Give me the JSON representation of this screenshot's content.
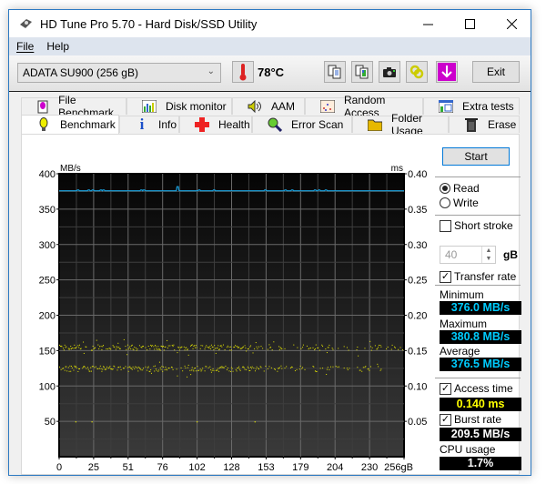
{
  "window": {
    "title": "HD Tune Pro 5.70 - Hard Disk/SSD Utility"
  },
  "menu": [
    {
      "label": "File",
      "accel": "F"
    },
    {
      "label": "Help",
      "accel": "H"
    }
  ],
  "toolbar": {
    "drive": "ADATA SU900 (256 gB)",
    "temperature": "78°C",
    "icons": [
      "copy-text-icon",
      "copy-screenshot-icon",
      "camera-icon",
      "options-icon",
      "save-down-icon"
    ],
    "exit_label": "Exit"
  },
  "tabs_top": [
    {
      "label": "File Benchmark",
      "icon": "file-benchmark-icon"
    },
    {
      "label": "Disk monitor",
      "icon": "disk-monitor-icon"
    },
    {
      "label": "AAM",
      "icon": "speaker-icon"
    },
    {
      "label": "Random Access",
      "icon": "random-access-icon"
    },
    {
      "label": "Extra tests",
      "icon": "extra-tests-icon"
    }
  ],
  "tabs_bottom": [
    {
      "label": "Benchmark",
      "icon": "bulb-icon",
      "active": true
    },
    {
      "label": "Info",
      "icon": "info-icon"
    },
    {
      "label": "Health",
      "icon": "health-cross-icon"
    },
    {
      "label": "Error Scan",
      "icon": "magnifier-icon"
    },
    {
      "label": "Folder Usage",
      "icon": "folder-icon"
    },
    {
      "label": "Erase",
      "icon": "trash-icon"
    }
  ],
  "side": {
    "start_label": "Start",
    "read_label": "Read",
    "write_label": "Write",
    "mode": "read",
    "short_stroke_label": "Short stroke",
    "short_stroke_checked": false,
    "short_stroke_value": "40",
    "short_stroke_unit": "gB",
    "transfer_rate_label": "Transfer rate",
    "transfer_rate_checked": true,
    "minimum_label": "Minimum",
    "minimum_value": "376.0 MB/s",
    "maximum_label": "Maximum",
    "maximum_value": "380.8 MB/s",
    "average_label": "Average",
    "average_value": "376.5 MB/s",
    "access_time_label": "Access time",
    "access_time_checked": true,
    "access_time_value": "0.140 ms",
    "burst_rate_label": "Burst rate",
    "burst_rate_checked": true,
    "burst_rate_value": "209.5 MB/s",
    "cpu_label": "CPU usage",
    "cpu_value": "1.7%",
    "colors": {
      "transfer": "#00ccff",
      "access": "#ffff00",
      "burst": "#ffffff",
      "cpu": "#ffffff"
    }
  },
  "chart_data": {
    "type": "line",
    "left_axis": {
      "label": "MB/s",
      "range": [
        0,
        400
      ],
      "ticks": [
        50,
        100,
        150,
        200,
        250,
        300,
        350,
        400
      ]
    },
    "right_axis": {
      "label": "ms",
      "range": [
        0,
        0.4
      ],
      "ticks": [
        "0.05",
        "0.10",
        "0.15",
        "0.20",
        "0.25",
        "0.30",
        "0.35",
        "0.40"
      ]
    },
    "x_axis": {
      "unit": "gB",
      "range": [
        0,
        256
      ],
      "ticks": [
        "0",
        "25",
        "51",
        "76",
        "102",
        "128",
        "153",
        "179",
        "204",
        "230",
        "256gB"
      ]
    },
    "grid": true,
    "series": [
      {
        "name": "Transfer rate",
        "color": "#1aa3e0",
        "kind": "line",
        "baseline": 376.0,
        "peak": 380.8,
        "spike_positions_gB": [
          14,
          22,
          25,
          31,
          33,
          61,
          63,
          104,
          115,
          153,
          168,
          173,
          190,
          193,
          198
        ]
      },
      {
        "name": "Access time",
        "color": "#e6e600",
        "kind": "scatter",
        "bands_ms": [
          0.155,
          0.125
        ],
        "band_spread_ms": 0.008,
        "outliers_ms": [
          [
            12,
            0.05
          ],
          [
            24,
            0.05
          ],
          [
            102,
            0.05
          ],
          [
            145,
            0.05
          ]
        ]
      }
    ]
  }
}
